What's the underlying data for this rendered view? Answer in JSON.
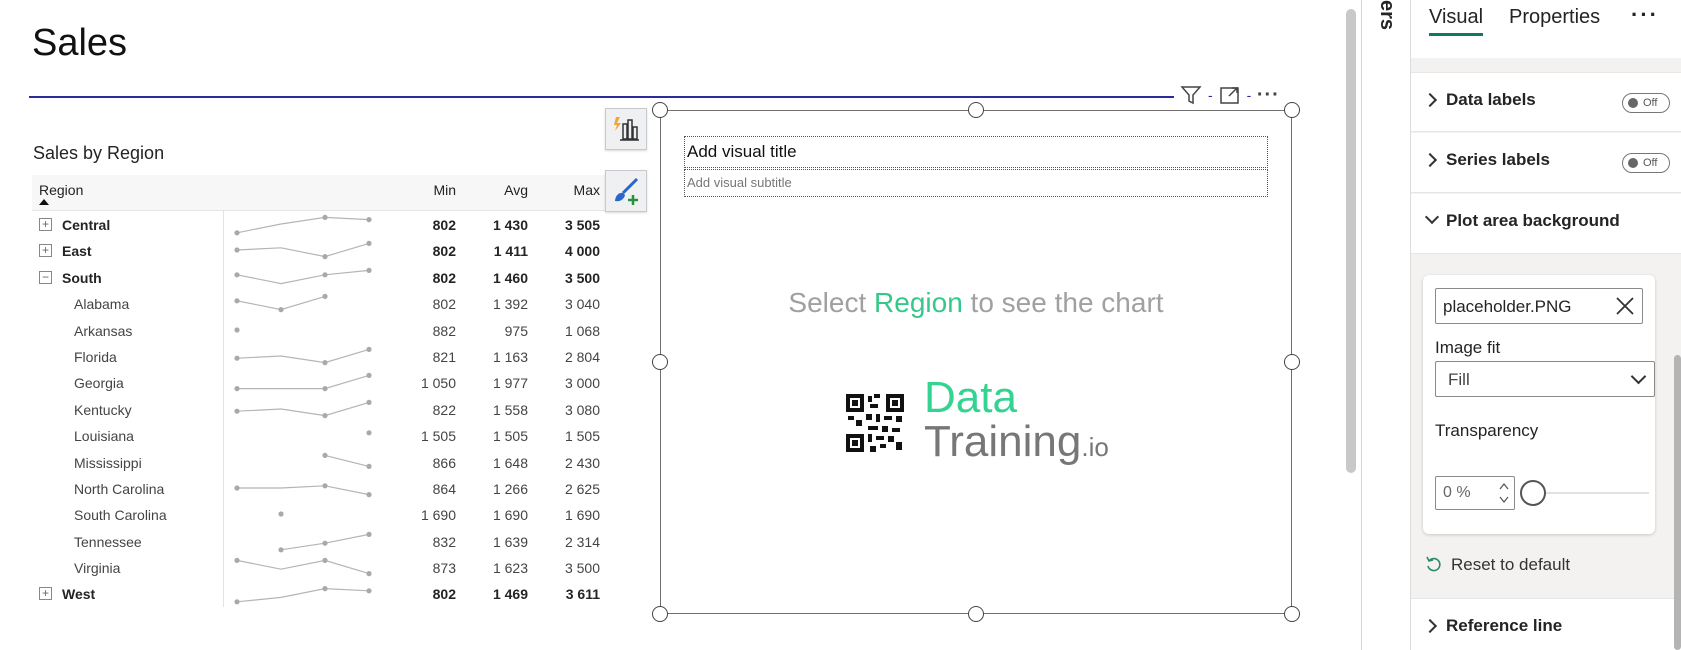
{
  "report": {
    "title": "Sales",
    "table_title": "Sales by Region",
    "columns": {
      "region": "Region",
      "min": "Min",
      "avg": "Avg",
      "max": "Max"
    },
    "rows": [
      {
        "label": "Central",
        "min": "802",
        "avg": "1 430",
        "max": "3 505",
        "level": 0,
        "expander": "+",
        "bold": true,
        "spark": [
          null,
          [
            0,
            9
          ],
          [
            1,
            5
          ],
          [
            2,
            2
          ],
          [
            3,
            3
          ]
        ]
      },
      {
        "label": "East",
        "min": "802",
        "avg": "1 411",
        "max": "4 000",
        "level": 0,
        "expander": "+",
        "bold": true,
        "spark": [
          [
            0,
            5
          ],
          [
            1,
            4
          ],
          [
            2,
            8
          ],
          [
            3,
            2
          ]
        ]
      },
      {
        "label": "South",
        "min": "802",
        "avg": "1 460",
        "max": "3 500",
        "level": 0,
        "expander": "−",
        "bold": true,
        "spark": [
          [
            0,
            4
          ],
          [
            1,
            8
          ],
          [
            2,
            4
          ],
          [
            3,
            2
          ]
        ]
      },
      {
        "label": "Alabama",
        "min": "802",
        "avg": "1 392",
        "max": "3 040",
        "level": 1,
        "spark": [
          [
            0,
            4
          ],
          [
            1,
            8
          ],
          [
            2,
            2
          ]
        ]
      },
      {
        "label": "Arkansas",
        "min": "882",
        "avg": "975",
        "max": "1 068",
        "level": 1,
        "spark": [
          [
            0,
            5
          ]
        ]
      },
      {
        "label": "Florida",
        "min": "821",
        "avg": "1 163",
        "max": "2 804",
        "level": 1,
        "spark": [
          [
            0,
            6
          ],
          [
            1,
            5
          ],
          [
            2,
            8
          ],
          [
            3,
            2
          ]
        ]
      },
      {
        "label": "Georgia",
        "min": "1 050",
        "avg": "1 977",
        "max": "3 000",
        "level": 1,
        "spark": [
          [
            0,
            8
          ],
          [
            1,
            8
          ],
          [
            2,
            8
          ],
          [
            3,
            2
          ]
        ]
      },
      {
        "label": "Kentucky",
        "min": "822",
        "avg": "1 558",
        "max": "3 080",
        "level": 1,
        "spark": [
          [
            0,
            6
          ],
          [
            1,
            5
          ],
          [
            2,
            8
          ],
          [
            3,
            2
          ]
        ]
      },
      {
        "label": "Louisiana",
        "min": "1 505",
        "avg": "1 505",
        "max": "1 505",
        "level": 1,
        "spark": [
          [
            3,
            4
          ]
        ]
      },
      {
        "label": "Mississippi",
        "min": "866",
        "avg": "1 648",
        "max": "2 430",
        "level": 1,
        "spark": [
          [
            2,
            2
          ],
          [
            3,
            7
          ]
        ]
      },
      {
        "label": "North Carolina",
        "min": "864",
        "avg": "1 266",
        "max": "2 625",
        "level": 1,
        "spark": [
          [
            0,
            5
          ],
          [
            1,
            5
          ],
          [
            2,
            4
          ],
          [
            3,
            8
          ]
        ]
      },
      {
        "label": "South Carolina",
        "min": "1 690",
        "avg": "1 690",
        "max": "1 690",
        "level": 1,
        "spark": [
          [
            1,
            5
          ]
        ]
      },
      {
        "label": "Tennessee",
        "min": "832",
        "avg": "1 639",
        "max": "2 314",
        "level": 1,
        "spark": [
          [
            1,
            9
          ],
          [
            2,
            6
          ],
          [
            3,
            2
          ]
        ]
      },
      {
        "label": "Virginia",
        "min": "873",
        "avg": "1 623",
        "max": "3 500",
        "level": 1,
        "spark": [
          [
            0,
            2
          ],
          [
            1,
            6
          ],
          [
            2,
            2
          ],
          [
            3,
            8
          ]
        ]
      },
      {
        "label": "West",
        "min": "802",
        "avg": "1 469",
        "max": "3 611",
        "level": 0,
        "expander": "+",
        "bold": true,
        "spark": [
          [
            0,
            9
          ],
          [
            1,
            7
          ],
          [
            2,
            3
          ],
          [
            3,
            4
          ]
        ]
      }
    ]
  },
  "visual": {
    "title_placeholder": "Add visual title",
    "subtitle_placeholder": "Add visual subtitle",
    "message_before": "Select ",
    "message_accent": "Region",
    "message_after": " to see the chart",
    "logo_data": "Data",
    "logo_training": "Training",
    "logo_io": ".io",
    "accent_color": "#34c98b"
  },
  "filters_tab": "ers",
  "pane": {
    "tabs": [
      "Visual",
      "Properties"
    ],
    "active_tab": "Visual",
    "more": "···",
    "sections": [
      {
        "label": "Data labels",
        "toggle": "Off",
        "expanded": false
      },
      {
        "label": "Series labels",
        "toggle": "Off",
        "expanded": false
      },
      {
        "label": "Plot area background",
        "expanded": true
      },
      {
        "label": "Reference line",
        "expanded": false
      }
    ],
    "image_file": "placeholder.PNG",
    "image_fit_label": "Image fit",
    "image_fit_value": "Fill",
    "transparency_label": "Transparency",
    "transparency_value": "0 %",
    "transparency_percent": 0,
    "reset_label": "Reset to default"
  }
}
